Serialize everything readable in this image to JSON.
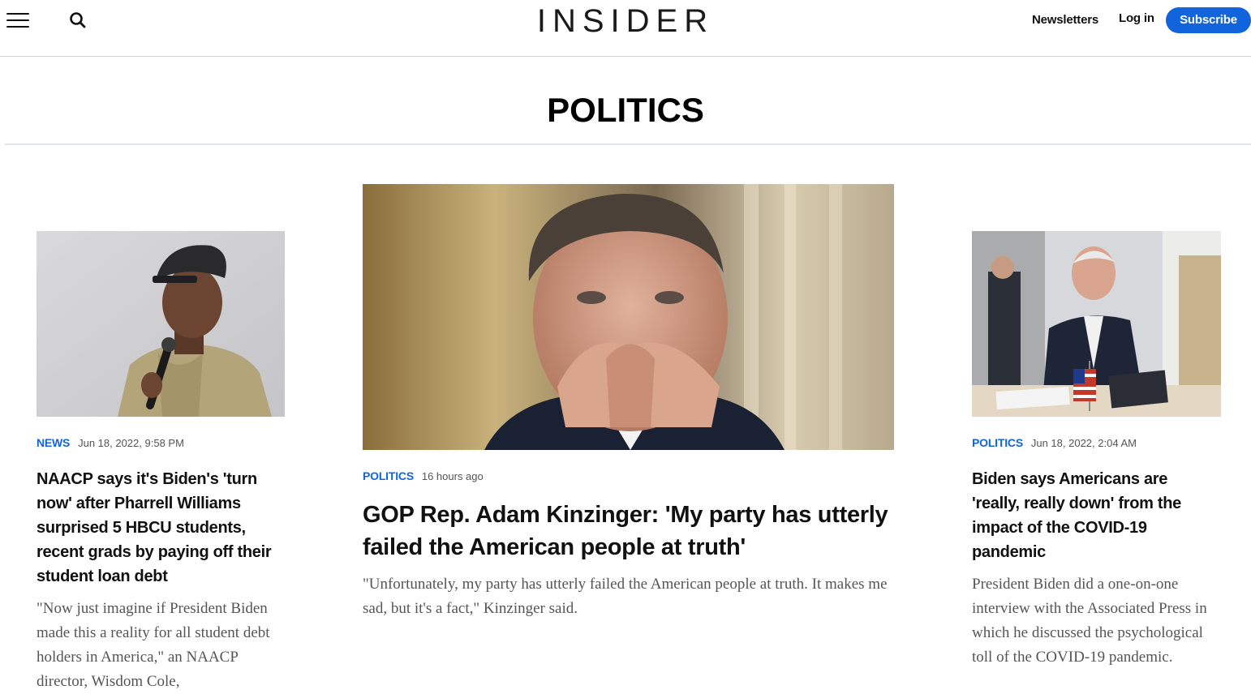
{
  "header": {
    "logo": "INSIDER",
    "newsletters_label": "Newsletters",
    "login_label": "Log in",
    "subscribe_label": "Subscribe",
    "accent": "#1264dc"
  },
  "section": {
    "title": "POLITICS"
  },
  "articles": [
    {
      "vertical": "NEWS",
      "timestamp": "Jun 18, 2022, 9:58 PM",
      "headline": "NAACP says it's Biden's 'turn now' after Pharrell Williams surprised 5 HBCU students, recent grads by paying off their student loan debt",
      "dek": "\"Now just imagine if President Biden made this a reality for all student debt holders in America,\" an NAACP director, Wisdom Cole,",
      "image_icon": "photo-man-with-microphone"
    },
    {
      "vertical": "POLITICS",
      "timestamp": "16 hours ago",
      "headline": "GOP Rep. Adam Kinzinger: 'My party has utterly failed the American people at truth'",
      "dek": "\"Unfortunately, my party has utterly failed the American people at truth. It makes me sad, but it's a fact,\" Kinzinger said.",
      "image_icon": "photo-man-hands-clasped"
    },
    {
      "vertical": "POLITICS",
      "timestamp": "Jun 18, 2022, 2:04 AM",
      "headline": "Biden says Americans are 'really, really down' from the impact of the COVID-19 pandemic",
      "dek": "President Biden did a one-on-one interview with the Associated Press in which he discussed the psychological toll of the COVID-19 pandemic.",
      "image_icon": "photo-man-at-desk-with-flag"
    }
  ]
}
